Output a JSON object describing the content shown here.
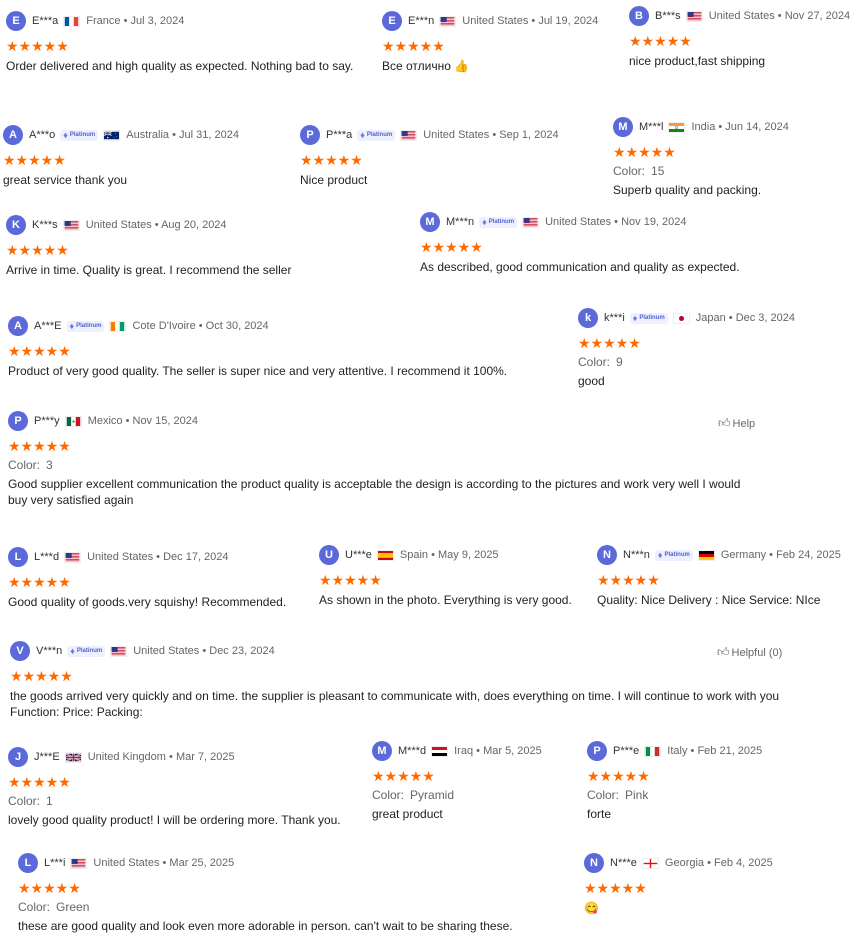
{
  "badge_label": "Platinum",
  "colors": {
    "star": "#ff6a00",
    "avatar": "#5b6ad8",
    "badge_bg": "#eef0ff"
  },
  "reviews": [
    {
      "initial": "E",
      "name": "E***a",
      "flag": "fr",
      "country": "France",
      "date": "Jul 3, 2024",
      "platinum": false,
      "color": null,
      "text": "Order delivered and high quality as expected. Nothing bad to say."
    },
    {
      "initial": "E",
      "name": "E***n",
      "flag": "us",
      "country": "United States",
      "date": "Jul 19, 2024",
      "platinum": false,
      "color": null,
      "text": "Все отлично 👍"
    },
    {
      "initial": "B",
      "name": "B***s",
      "flag": "us",
      "country": "United States",
      "date": "Nov 27, 2024",
      "platinum": false,
      "color": null,
      "text": "nice product,fast shipping"
    },
    {
      "initial": "A",
      "name": "A***o",
      "flag": "au",
      "country": "Australia",
      "date": "Jul 31, 2024",
      "platinum": true,
      "color": null,
      "text": "great service thank you"
    },
    {
      "initial": "P",
      "name": "P***a",
      "flag": "us",
      "country": "United States",
      "date": "Sep 1, 2024",
      "platinum": true,
      "color": null,
      "text": "Nice product"
    },
    {
      "initial": "M",
      "name": "M***l",
      "flag": "in",
      "country": "India",
      "date": "Jun 14, 2024",
      "platinum": false,
      "color": "15",
      "text": "Superb quality and packing."
    },
    {
      "initial": "K",
      "name": "K***s",
      "flag": "us",
      "country": "United States",
      "date": "Aug 20, 2024",
      "platinum": false,
      "color": null,
      "text": "Arrive in time. Quality is great. I recommend the seller"
    },
    {
      "initial": "M",
      "name": "M***n",
      "flag": "us",
      "country": "United States",
      "date": "Nov 19, 2024",
      "platinum": true,
      "color": null,
      "text": "As described, good communication and quality as expected."
    },
    {
      "initial": "A",
      "name": "A***E",
      "flag": "ci",
      "country": "Cote D'Ivoire",
      "date": "Oct 30, 2024",
      "platinum": true,
      "color": null,
      "text": "Product of very good quality. The seller is super nice and very attentive. I recommend it 100%."
    },
    {
      "initial": "k",
      "name": "k***i",
      "flag": "jp",
      "country": "Japan",
      "date": "Dec 3, 2024",
      "platinum": true,
      "color": "9",
      "text": "good"
    },
    {
      "initial": "P",
      "name": "P***y",
      "flag": "mx",
      "country": "Mexico",
      "date": "Nov 15, 2024",
      "platinum": false,
      "color": "3",
      "text": "Good supplier excellent communication the product quality is acceptable the design is according to the pictures and work very well I would buy very satisfied again"
    },
    {
      "initial": "L",
      "name": "L***d",
      "flag": "us",
      "country": "United States",
      "date": "Dec 17, 2024",
      "platinum": false,
      "color": null,
      "text": "Good quality of goods.very squishy! Recommended."
    },
    {
      "initial": "U",
      "name": "U***e",
      "flag": "es",
      "country": "Spain",
      "date": "May 9, 2025",
      "platinum": false,
      "color": null,
      "text": "As shown in the photo. Everything is very good."
    },
    {
      "initial": "N",
      "name": "N***n",
      "flag": "de",
      "country": "Germany",
      "date": "Feb 24, 2025",
      "platinum": true,
      "color": null,
      "text": "Quality: Nice Delivery : Nice Service: NIce"
    },
    {
      "initial": "V",
      "name": "V***n",
      "flag": "us",
      "country": "United States",
      "date": "Dec 23, 2024",
      "platinum": true,
      "color": null,
      "text": "the goods arrived very quickly and on time. the supplier is pleasant to communicate with, does everything on time. I will continue to work with you Function:  Price:  Packing:"
    },
    {
      "initial": "J",
      "name": "J***E",
      "flag": "gb",
      "country": "United Kingdom",
      "date": "Mar 7, 2025",
      "platinum": false,
      "color": "1",
      "text": "lovely good quality product! I will be ordering more. Thank you."
    },
    {
      "initial": "M",
      "name": "M***d",
      "flag": "iq",
      "country": "Iraq",
      "date": "Mar 5, 2025",
      "platinum": false,
      "color": "Pyramid",
      "text": "great product"
    },
    {
      "initial": "P",
      "name": "P***e",
      "flag": "it",
      "country": "Italy",
      "date": "Feb 21, 2025",
      "platinum": false,
      "color": "Pink",
      "text": "forte"
    },
    {
      "initial": "L",
      "name": "L***i",
      "flag": "us",
      "country": "United States",
      "date": "Mar 25, 2025",
      "platinum": false,
      "color": "Green",
      "text": "these are good quality and look even more adorable in person. can't wait to be sharing these."
    },
    {
      "initial": "N",
      "name": "N***e",
      "flag": "ge",
      "country": "Georgia",
      "date": "Feb 4, 2025",
      "platinum": false,
      "color": null,
      "text": "😋"
    }
  ],
  "stars_text": "★★★★★",
  "color_label": "Color:",
  "helpful": [
    {
      "label": "Help"
    },
    {
      "label": "Helpful (0)"
    }
  ]
}
